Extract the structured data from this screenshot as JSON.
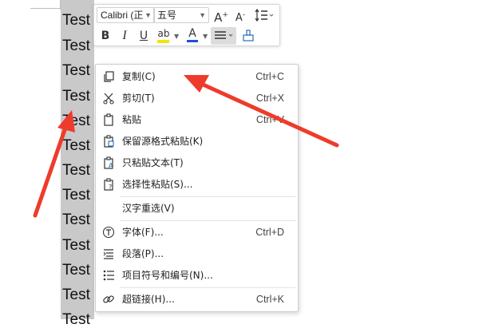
{
  "document": {
    "lines": [
      "Test",
      "Test",
      "Test",
      "Test",
      "Test",
      "Test",
      "Test",
      "Test",
      "Test",
      "Test",
      "Test",
      "Test",
      "Test"
    ]
  },
  "mini_toolbar": {
    "font_name": "Calibri (正",
    "font_size": "五号",
    "grow_font_icon": "A+",
    "shrink_font_icon": "A-",
    "line_spacing_icon": "line-spacing",
    "bold": "B",
    "italic": "I",
    "underline": "U",
    "highlight": "ab",
    "font_color": "A",
    "highlight_color": "#f2e600",
    "font_color_bar": "#1f4fd8"
  },
  "context_menu": {
    "items": [
      {
        "label": "复制(C)",
        "shortcut": "Ctrl+C",
        "icon": "copy-icon"
      },
      {
        "label": "剪切(T)",
        "shortcut": "Ctrl+X",
        "icon": "scissors-icon"
      },
      {
        "label": "粘贴",
        "shortcut": "Ctrl+V",
        "icon": "paste-icon"
      },
      {
        "label": "保留源格式粘贴(K)",
        "shortcut": "",
        "icon": "paste-keep-format-icon"
      },
      {
        "label": "只粘贴文本(T)",
        "shortcut": "",
        "icon": "paste-text-only-icon"
      },
      {
        "label": "选择性粘贴(S)...",
        "shortcut": "",
        "icon": "paste-special-icon"
      },
      {
        "label": "汉字重选(V)",
        "shortcut": "",
        "icon": ""
      },
      {
        "label": "字体(F)...",
        "shortcut": "Ctrl+D",
        "icon": "font-icon"
      },
      {
        "label": "段落(P)...",
        "shortcut": "",
        "icon": "paragraph-icon"
      },
      {
        "label": "项目符号和编号(N)...",
        "shortcut": "",
        "icon": "bullet-list-icon"
      },
      {
        "label": "超链接(H)...",
        "shortcut": "Ctrl+K",
        "icon": "link-icon"
      }
    ]
  },
  "annotation": {
    "arrow_color": "#ee3b2b"
  }
}
